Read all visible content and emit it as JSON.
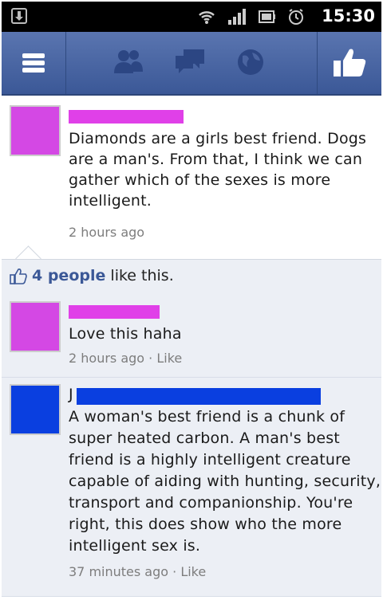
{
  "status_bar": {
    "time": "15:30",
    "icons": [
      "download-notification-icon",
      "wifi-icon",
      "signal-bars-icon",
      "battery-icon",
      "alarm-icon"
    ]
  },
  "top_bar": {
    "icons": [
      "menu-icon",
      "friend-requests-icon",
      "messages-icon",
      "notifications-globe-icon",
      "like-thumb-icon"
    ]
  },
  "post": {
    "author": "",
    "author_redaction_color": "#e040e8",
    "avatar_color": "#d448e4",
    "text": "Diamonds are a girls best friend. Dogs are a man's. From that, I think we can gather which of the sexes is more intelligent.",
    "lines": [
      "Diamonds are a girls best friend. Dogs",
      "are a man's. From that, I think we can",
      "gather which of the sexes is more",
      "intelligent."
    ],
    "time": "2 hours ago"
  },
  "likes": {
    "count_text": "4 people",
    "suffix": " like this."
  },
  "comments": [
    {
      "author": "",
      "avatar_color": "#d448e4",
      "redaction_color": "#e040e8",
      "text": "Love this haha",
      "time": "2 hours ago",
      "separator": " · ",
      "like_label": "Like"
    },
    {
      "author_initial": "J",
      "avatar_color": "#0a3fe0",
      "redaction_color": "#0a3fe0",
      "text": "A woman's best friend is a chunk of super heated carbon. A man's best friend is a highly intelligent creature capable of aiding with hunting, security, transport and companionship. You're right, this does show who the more intelligent sex is.",
      "lines": [
        "A woman's best friend is a chunk of",
        "super heated carbon. A man's best",
        "friend is a highly intelligent creature",
        "capable of aiding with hunting, security,",
        "transport and companionship. You're",
        "right, this does show who the more",
        "intelligent sex is."
      ],
      "time": "37 minutes ago",
      "separator": " · ",
      "like_label": "Like"
    }
  ],
  "colors": {
    "facebook_blue": "#3b5897",
    "comment_bg": "#eceff5",
    "meta_gray": "#7d7d7d"
  }
}
